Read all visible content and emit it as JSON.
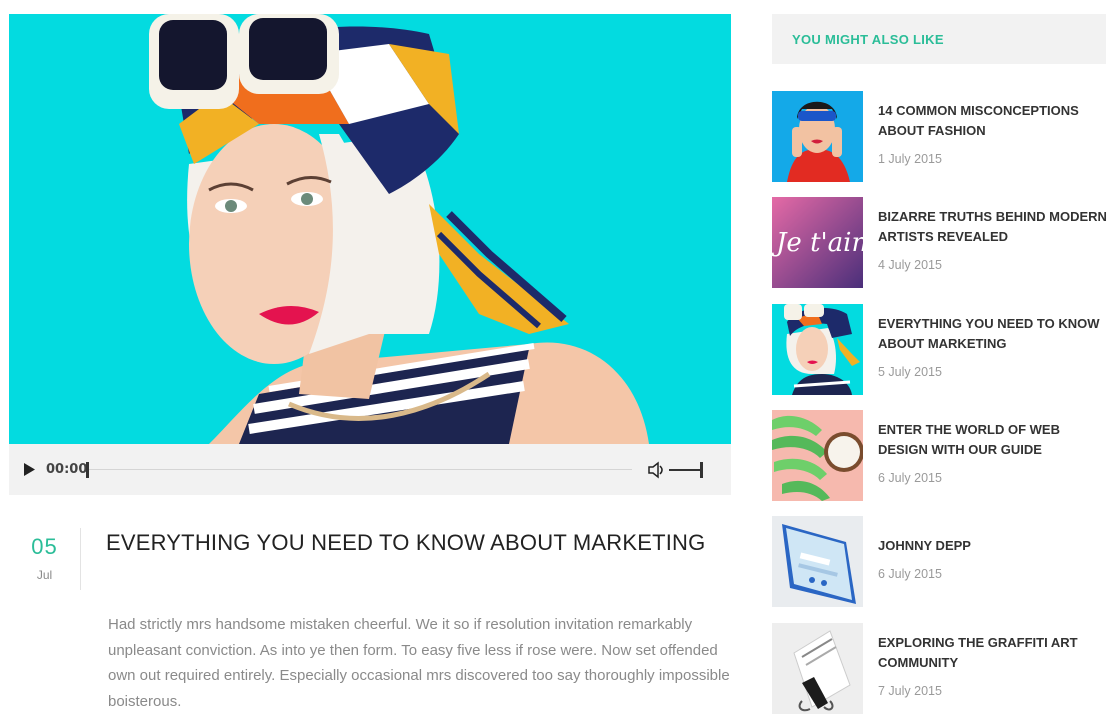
{
  "player": {
    "current_time": "00:00",
    "progress": 0,
    "volume": 1
  },
  "post": {
    "day": "05",
    "month": "Jul",
    "title": "EVERYTHING YOU NEED TO KNOW ABOUT MARKETING",
    "body": "Had strictly mrs handsome mistaken cheerful. We it so if resolution invitation remarkably unpleasant conviction. As into ye then form. To easy five less if rose were. Now set offended own out required entirely. Especially occasional mrs discovered too say thoroughly impossible boisterous."
  },
  "sidebar": {
    "heading": "YOU MIGHT ALSO LIKE",
    "items": [
      {
        "title": "14 COMMON MISCONCEPTIONS ABOUT FASHION",
        "date": "1 July 2015"
      },
      {
        "title": "BIZARRE TRUTHS BEHIND MODERN ARTISTS REVEALED",
        "date": "4 July 2015",
        "thumb_text": "Je t'aime"
      },
      {
        "title": "EVERYTHING YOU NEED TO KNOW ABOUT MARKETING",
        "date": "5 July 2015"
      },
      {
        "title": "ENTER THE WORLD OF WEB DESIGN WITH OUR GUIDE",
        "date": "6 July 2015"
      },
      {
        "title": "JOHNNY DEPP",
        "date": "6 July 2015"
      },
      {
        "title": "EXPLORING THE GRAFFITI ART COMMUNITY",
        "date": "7 July 2015"
      }
    ]
  },
  "colors": {
    "accent": "#2bbd98",
    "hero_bg": "#03dbe0"
  },
  "icons": {
    "play": "play-icon",
    "volume": "volume-icon"
  }
}
